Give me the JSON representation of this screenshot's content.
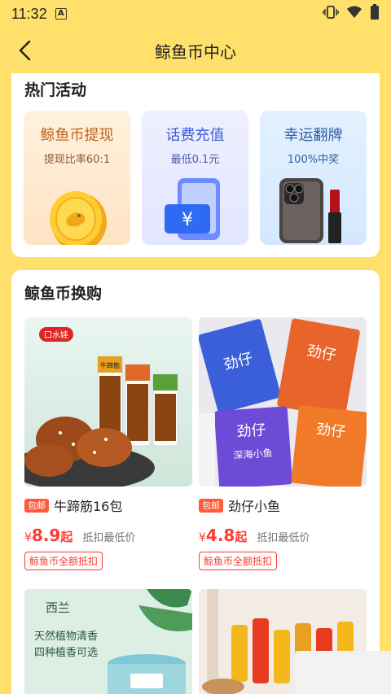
{
  "status": {
    "time": "11:32",
    "notif": "A"
  },
  "nav": {
    "title": "鲸鱼币中心"
  },
  "activities": {
    "title": "热门活动",
    "items": [
      {
        "title": "鲸鱼币提现",
        "subtitle": "提现比率60:1"
      },
      {
        "title": "话费充值",
        "subtitle": "最低0.1元"
      },
      {
        "title": "幸运翻牌",
        "subtitle": "100%中奖"
      }
    ]
  },
  "shop": {
    "title": "鲸鱼币换购",
    "products": [
      {
        "tag": "包邮",
        "name": "牛蹄筋16包",
        "currency": "¥",
        "price": "8.9",
        "suffix": "起",
        "note": "抵扣最低价",
        "coin_label": "鲸鱼币全额抵扣",
        "img_brand": "口水娃",
        "img_sub": "牛蹄筋"
      },
      {
        "tag": "包邮",
        "name": "劲仔小鱼",
        "currency": "¥",
        "price": "4.8",
        "suffix": "起",
        "note": "抵扣最低价",
        "coin_label": "鲸鱼币全额抵扣",
        "img_brand": "劲仔",
        "img_sub": "深海小鱼"
      },
      {
        "img_brand": "西兰",
        "img_line1": "天然植物清香",
        "img_line2": "四种植香可选"
      },
      {
        "img_brand": ""
      }
    ]
  },
  "colors": {
    "page_bg": "#FFE06B",
    "accent_red": "#FF3B30",
    "tag_orange": "#FF5A3B"
  }
}
